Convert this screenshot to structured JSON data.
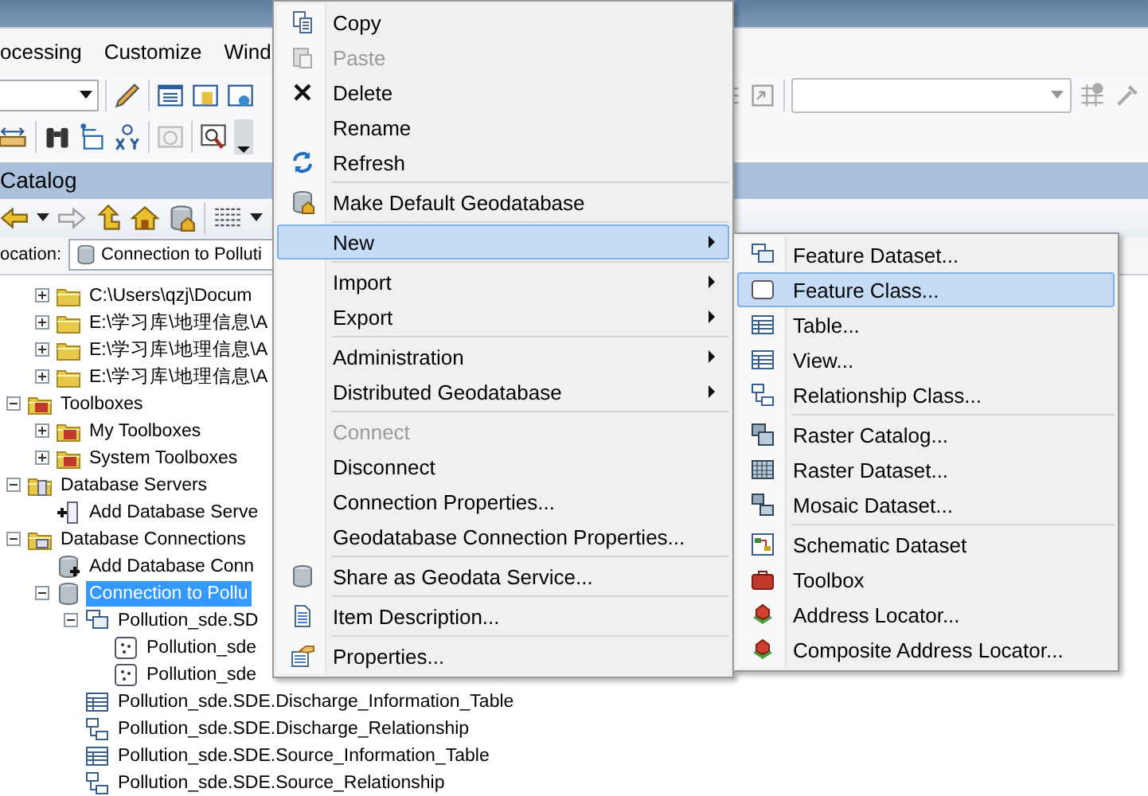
{
  "menu_bar": {
    "items": [
      "ocessing",
      "Customize",
      "Wind"
    ]
  },
  "catalog": {
    "title": "Catalog",
    "location_label": "ocation:",
    "location_value": "Connection to Polluti"
  },
  "tree": {
    "partial_branch": [
      {
        "label": "C:\\Users\\qzj\\Docum",
        "kind": "folder",
        "expanded": false,
        "selected": false
      },
      {
        "label": "E:\\学习库\\地理信息\\A",
        "kind": "folder",
        "expanded": false,
        "selected": false
      },
      {
        "label": "E:\\学习库\\地理信息\\A",
        "kind": "folder",
        "expanded": false,
        "selected": false
      },
      {
        "label": "E:\\学习库\\地理信息\\A",
        "kind": "folder",
        "expanded": false,
        "selected": false
      }
    ],
    "nodes": [
      {
        "label": "Toolboxes",
        "kind": "toolbox-folder",
        "expanded": true,
        "selected": false,
        "children": [
          {
            "label": "My Toolboxes",
            "kind": "toolbox-folder",
            "expanded": false,
            "selected": false
          },
          {
            "label": "System Toolboxes",
            "kind": "toolbox-folder",
            "expanded": false,
            "selected": false
          }
        ]
      },
      {
        "label": "Database Servers",
        "kind": "server-folder",
        "expanded": true,
        "selected": false,
        "children": [
          {
            "label": "Add Database Serve",
            "kind": "add-server",
            "selected": false
          }
        ]
      },
      {
        "label": "Database Connections",
        "kind": "connection-folder",
        "expanded": true,
        "selected": false,
        "children": [
          {
            "label": "Add Database Conn",
            "kind": "add-connection",
            "selected": false
          },
          {
            "label": "Connection to Pollu",
            "kind": "database",
            "expanded": true,
            "selected": true,
            "children": [
              {
                "label": "Pollution_sde.SD",
                "kind": "feature-dataset",
                "expanded": true,
                "selected": false,
                "children": [
                  {
                    "label": "Pollution_sde",
                    "kind": "feature-class",
                    "selected": false
                  },
                  {
                    "label": "Pollution_sde",
                    "kind": "feature-class",
                    "selected": false
                  }
                ]
              },
              {
                "label": "Pollution_sde.SDE.Discharge_Information_Table",
                "kind": "table",
                "selected": false
              },
              {
                "label": "Pollution_sde.SDE.Discharge_Relationship",
                "kind": "relationship",
                "selected": false
              },
              {
                "label": "Pollution_sde.SDE.Source_Information_Table",
                "kind": "table",
                "selected": false
              },
              {
                "label": "Pollution_sde.SDE.Source_Relationship",
                "kind": "relationship",
                "selected": false
              }
            ]
          }
        ]
      }
    ]
  },
  "context_menu": {
    "items": [
      {
        "kind": "item",
        "label": "Copy",
        "disabled": false,
        "selected": false,
        "submenu": false
      },
      {
        "kind": "item",
        "label": "Paste",
        "disabled": true,
        "selected": false,
        "submenu": false
      },
      {
        "kind": "item",
        "label": "Delete",
        "disabled": false,
        "selected": false,
        "submenu": false
      },
      {
        "kind": "item",
        "label": "Rename",
        "disabled": false,
        "selected": false,
        "submenu": false
      },
      {
        "kind": "item",
        "label": "Refresh",
        "disabled": false,
        "selected": false,
        "submenu": false
      },
      {
        "kind": "separator"
      },
      {
        "kind": "item",
        "label": "Make Default Geodatabase",
        "disabled": false,
        "selected": false,
        "submenu": false
      },
      {
        "kind": "separator"
      },
      {
        "kind": "item",
        "label": "New",
        "disabled": false,
        "selected": true,
        "submenu": true
      },
      {
        "kind": "separator"
      },
      {
        "kind": "item",
        "label": "Import",
        "disabled": false,
        "selected": false,
        "submenu": true
      },
      {
        "kind": "item",
        "label": "Export",
        "disabled": false,
        "selected": false,
        "submenu": true
      },
      {
        "kind": "separator"
      },
      {
        "kind": "item",
        "label": "Administration",
        "disabled": false,
        "selected": false,
        "submenu": true
      },
      {
        "kind": "item",
        "label": "Distributed Geodatabase",
        "disabled": false,
        "selected": false,
        "submenu": true
      },
      {
        "kind": "separator"
      },
      {
        "kind": "item",
        "label": "Connect",
        "disabled": true,
        "selected": false,
        "submenu": false
      },
      {
        "kind": "item",
        "label": "Disconnect",
        "disabled": false,
        "selected": false,
        "submenu": false
      },
      {
        "kind": "item",
        "label": "Connection Properties...",
        "disabled": false,
        "selected": false,
        "submenu": false
      },
      {
        "kind": "item",
        "label": "Geodatabase Connection Properties...",
        "disabled": false,
        "selected": false,
        "submenu": false
      },
      {
        "kind": "separator"
      },
      {
        "kind": "item",
        "label": "Share as Geodata Service...",
        "disabled": false,
        "selected": false,
        "submenu": false
      },
      {
        "kind": "separator"
      },
      {
        "kind": "item",
        "label": "Item Description...",
        "disabled": false,
        "selected": false,
        "submenu": false
      },
      {
        "kind": "separator"
      },
      {
        "kind": "item",
        "label": "Properties...",
        "disabled": false,
        "selected": false,
        "submenu": false
      }
    ]
  },
  "new_submenu": {
    "items": [
      {
        "kind": "item",
        "label": "Feature Dataset...",
        "selected": false
      },
      {
        "kind": "item",
        "label": "Feature Class...",
        "selected": true
      },
      {
        "kind": "item",
        "label": "Table...",
        "selected": false
      },
      {
        "kind": "item",
        "label": "View...",
        "selected": false
      },
      {
        "kind": "item",
        "label": "Relationship Class...",
        "selected": false
      },
      {
        "kind": "separator"
      },
      {
        "kind": "item",
        "label": "Raster Catalog...",
        "selected": false
      },
      {
        "kind": "item",
        "label": "Raster Dataset...",
        "selected": false
      },
      {
        "kind": "item",
        "label": "Mosaic Dataset...",
        "selected": false
      },
      {
        "kind": "separator"
      },
      {
        "kind": "item",
        "label": "Schematic Dataset",
        "selected": false
      },
      {
        "kind": "item",
        "label": "Toolbox",
        "selected": false
      },
      {
        "kind": "item",
        "label": "Address Locator...",
        "selected": false
      },
      {
        "kind": "item",
        "label": "Composite Address Locator...",
        "selected": false
      }
    ]
  }
}
